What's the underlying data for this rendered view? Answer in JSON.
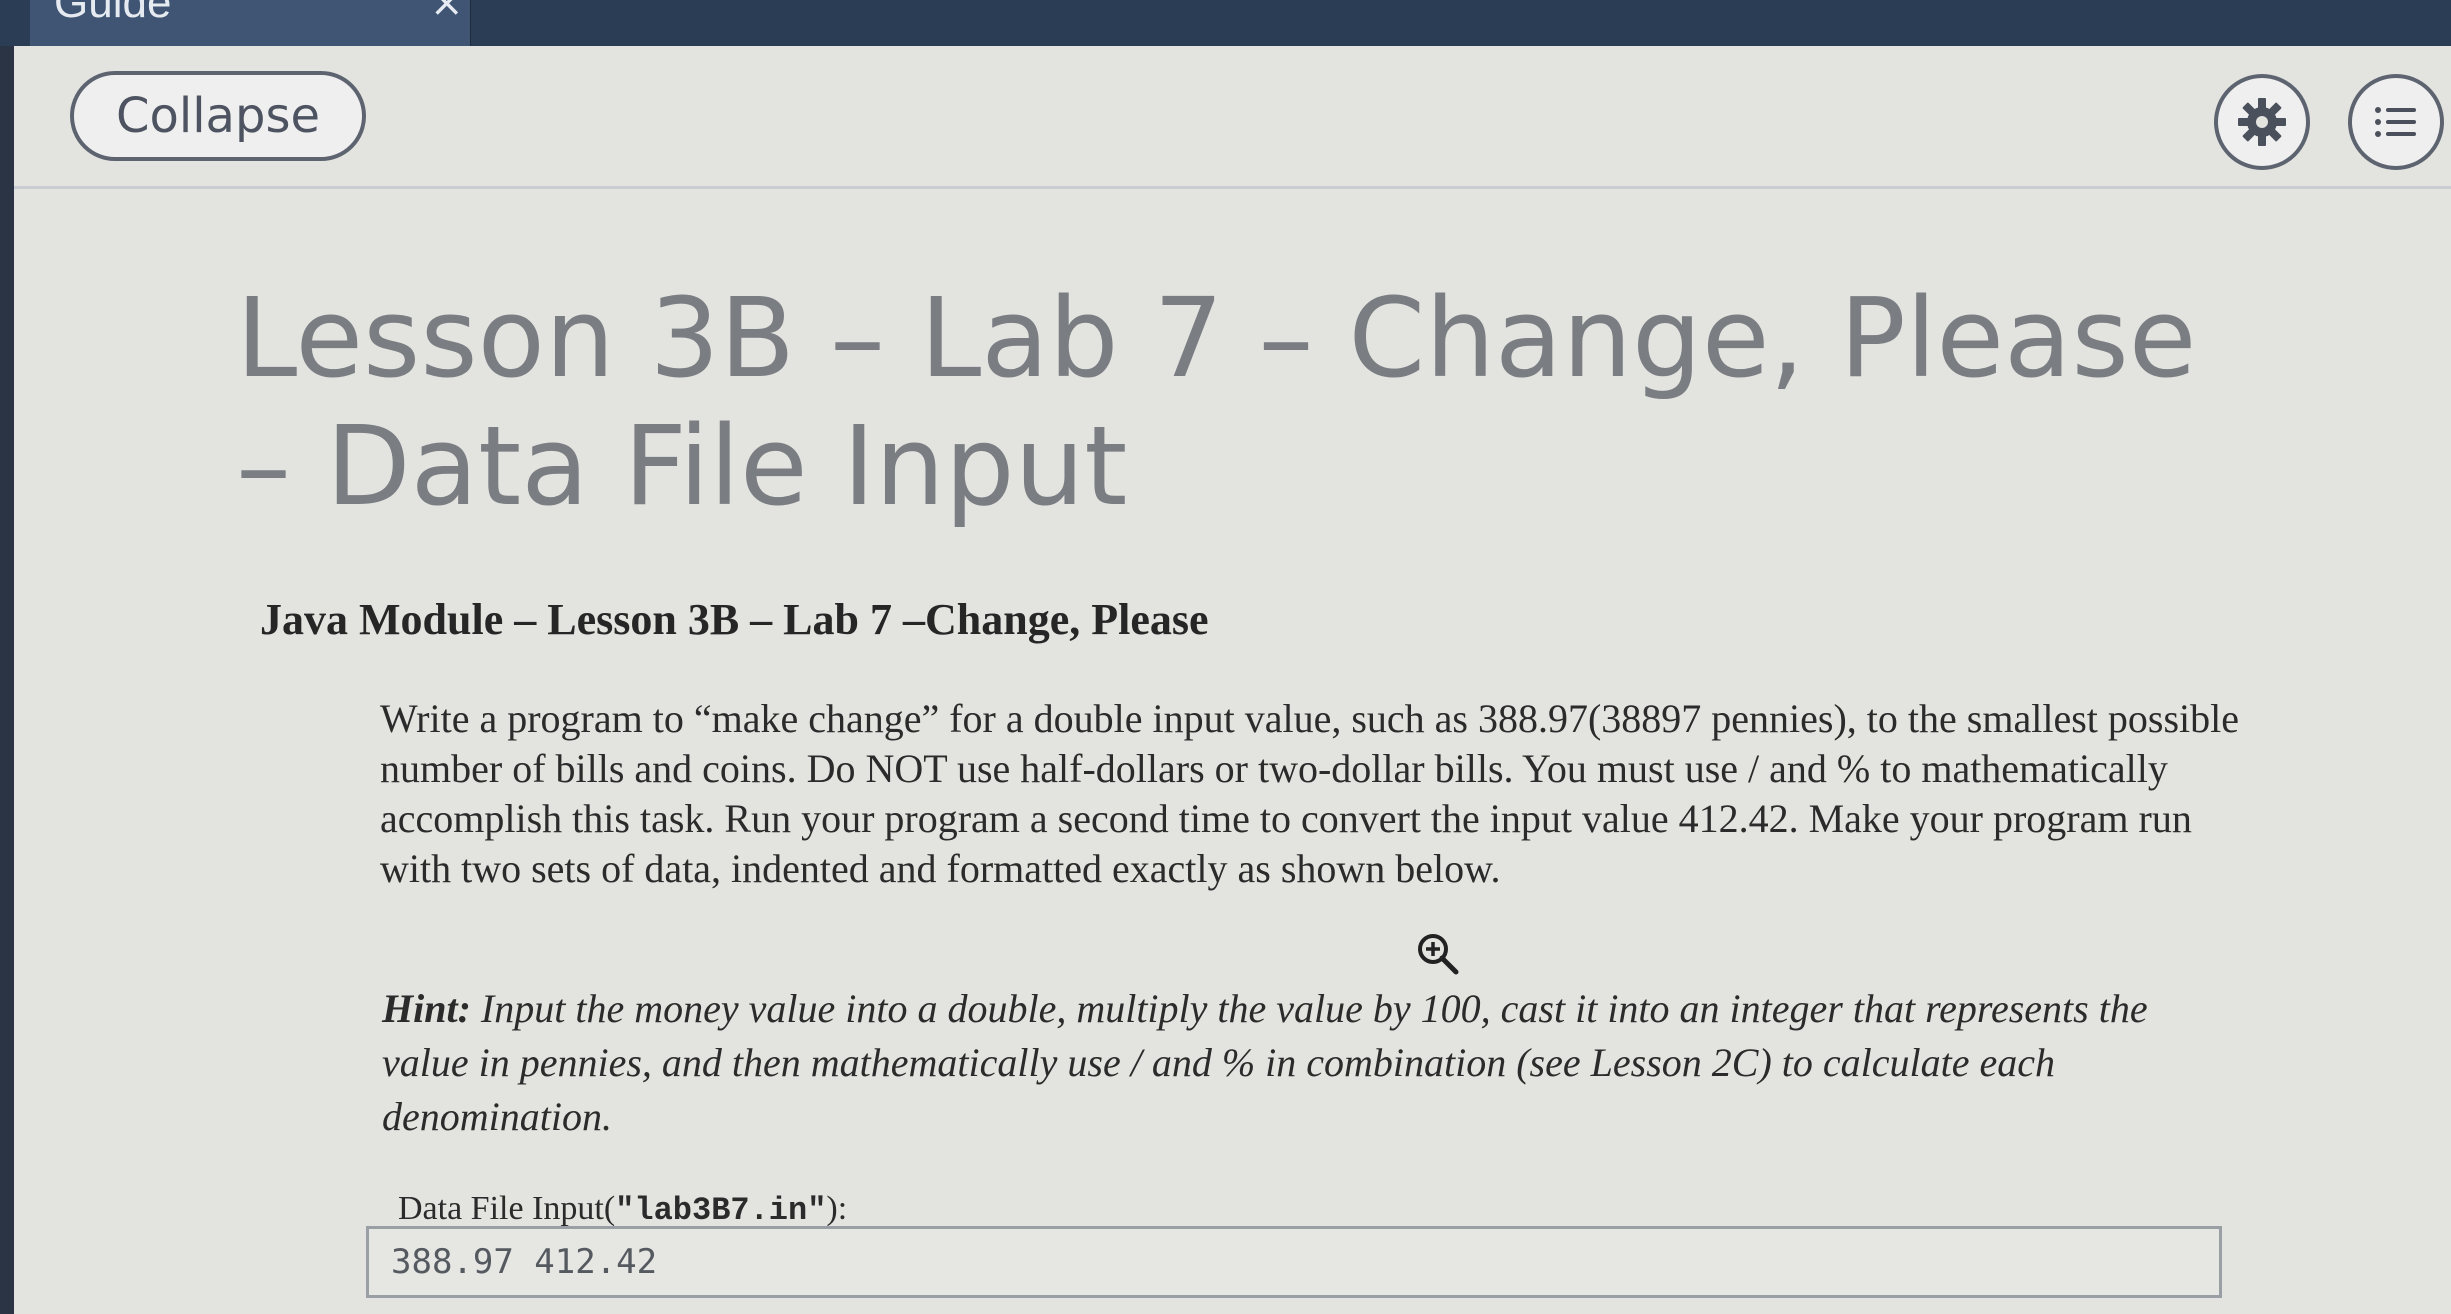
{
  "window": {
    "tab_title": "Guide",
    "tab_close": "×"
  },
  "toolbar": {
    "collapse_label": "Collapse"
  },
  "guide": {
    "title": "Lesson 3B – Lab 7 – Change, Please – Data File Input",
    "module_heading": "Java Module – Lesson 3B – Lab 7 –Change, Please",
    "description": "Write a program to “make change” for a double input value, such as 388.97(38897 pennies), to the smallest possible number of bills and coins.   Do NOT use half-dollars or two-dollar bills. You must use / and % to mathematically accomplish this task. Run your program a second time to convert the input value 412.42.   Make your program run with two sets of data, indented and formatted exactly as shown below.",
    "hint_label": "Hint:",
    "hint_text": " Input the money value into a double, multiply the value by 100, cast it into an integer that represents the value in pennies, and then mathematically use / and % in combination (see Lesson 2C) to calculate each denomination.",
    "data_file_label_prefix": "Data File Input(",
    "data_file_name": "\"lab3B7.in\"",
    "data_file_label_suffix": "):",
    "data_file_contents": "388.97 412.42"
  },
  "icons": {
    "settings": "gear-icon",
    "menu": "list-icon",
    "zoom": "zoom-in-icon"
  },
  "colors": {
    "page_background": "#e3e3e0",
    "title_gray": "#7a7d82",
    "top_bar": "#2b3d55"
  }
}
